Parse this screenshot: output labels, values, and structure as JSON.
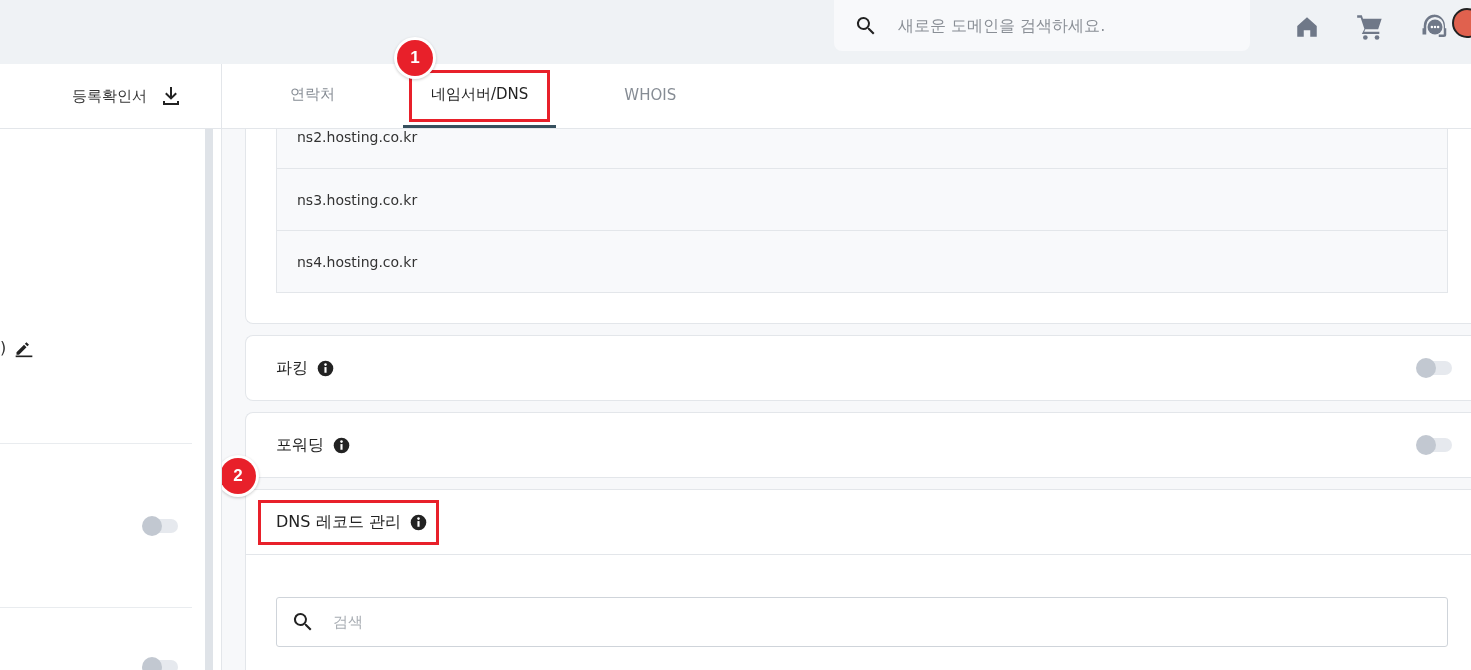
{
  "topbar": {
    "search": {
      "placeholder": "새로운 도메인을 검색하세요."
    }
  },
  "left_panel": {
    "certificate_button": "등록확인서",
    "rows": [
      {
        "kind": "text",
        "text": ")"
      },
      {
        "kind": "toggle",
        "on": false
      },
      {
        "kind": "toggle",
        "on": false
      }
    ]
  },
  "tabs": [
    {
      "label": "연락처",
      "selected": false
    },
    {
      "label": "네임서버/DNS",
      "selected": true,
      "callout": "1"
    },
    {
      "label": "WHOIS",
      "selected": false
    }
  ],
  "nameservers": [
    "ns2.hosting.co.kr",
    "ns3.hosting.co.kr",
    "ns4.hosting.co.kr"
  ],
  "sections": [
    {
      "title": "파킹",
      "kind": "toggle",
      "on": false
    },
    {
      "title": "포워딩",
      "kind": "toggle",
      "on": false
    },
    {
      "title": "DNS 레코드 관리",
      "kind": "search",
      "callout": "2",
      "search": {
        "placeholder": "검색"
      }
    }
  ]
}
